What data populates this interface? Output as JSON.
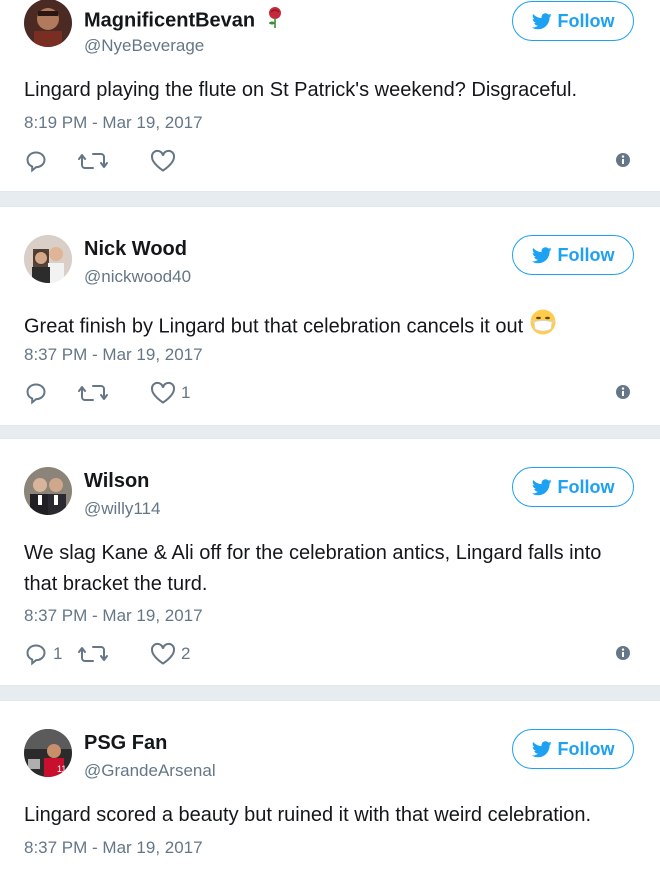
{
  "colors": {
    "accent": "#1da1f2",
    "secondary": "#657786",
    "background": "#e6ecf0"
  },
  "icons": {
    "reply": "reply-icon",
    "retweet": "retweet-icon",
    "like": "heart-icon",
    "info": "info-icon",
    "follow": "twitter-bird-icon",
    "emoji": "mask-face-emoji",
    "rose": "rose-emoji"
  },
  "tweets": [
    {
      "name": "MagnificentBevan",
      "handle": "@NyeBeverage",
      "follow_label": "Follow",
      "text": "Lingard playing the flute on St Patrick's weekend? Disgraceful.",
      "timestamp": "8:19 PM - Mar 19, 2017",
      "replies": "",
      "likes": ""
    },
    {
      "name": "Nick Wood",
      "handle": "@nickwood40",
      "follow_label": "Follow",
      "text": "Great finish by Lingard but that celebration cancels it out",
      "timestamp": "8:37 PM - Mar 19, 2017",
      "replies": "",
      "likes": "1"
    },
    {
      "name": "Wilson",
      "handle": "@willy114",
      "follow_label": "Follow",
      "text": "We slag Kane & Ali off for the celebration antics, Lingard falls into that bracket the turd.",
      "timestamp": "8:37 PM - Mar 19, 2017",
      "replies": "1",
      "likes": "2"
    },
    {
      "name": "PSG Fan",
      "handle": "@GrandeArsenal",
      "follow_label": "Follow",
      "text": "Lingard scored a beauty but ruined it with that weird celebration.",
      "timestamp": "8:37 PM - Mar 19, 2017"
    }
  ]
}
